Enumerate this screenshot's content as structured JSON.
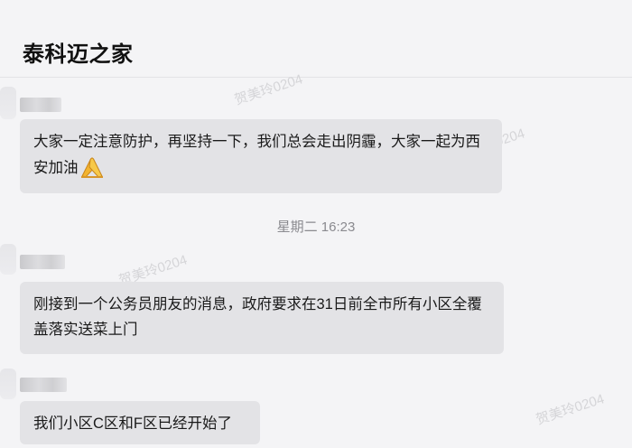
{
  "header": {
    "title": "泰科迈之家"
  },
  "watermark_text": "贺美玲0204",
  "messages": [
    {
      "text": "大家一定注意防护，再坚持一下，我们总会走出阴霾，大家一起为西安加油",
      "emoji": "hands-icon"
    },
    {
      "text": "刚接到一个公务员朋友的消息，政府要求在31日前全市所有小区全覆盖落实送菜上门"
    },
    {
      "text": "我们小区C区和F区已经开始了"
    }
  ],
  "timestamp": "星期二 16:23",
  "colors": {
    "bubble": "#e3e3e6",
    "background": "#f4f4f6",
    "timestamp": "#8a8a8f"
  }
}
